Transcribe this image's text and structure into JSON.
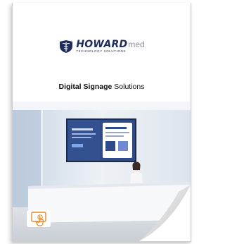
{
  "logo": {
    "brand": "HOWARD",
    "suffix": "med",
    "tagline": "TECHNOLOGY SOLUTIONS"
  },
  "title": {
    "bold": "Digital Signage",
    "rest": "Solutions"
  },
  "colors": {
    "brand_navy": "#1e2d5c",
    "accent_orange": "#e98a2a",
    "screen_blue": "#2f4a8a"
  },
  "icons": {
    "logo": "caduceus-badge",
    "touch": "touch-hand-icon"
  }
}
